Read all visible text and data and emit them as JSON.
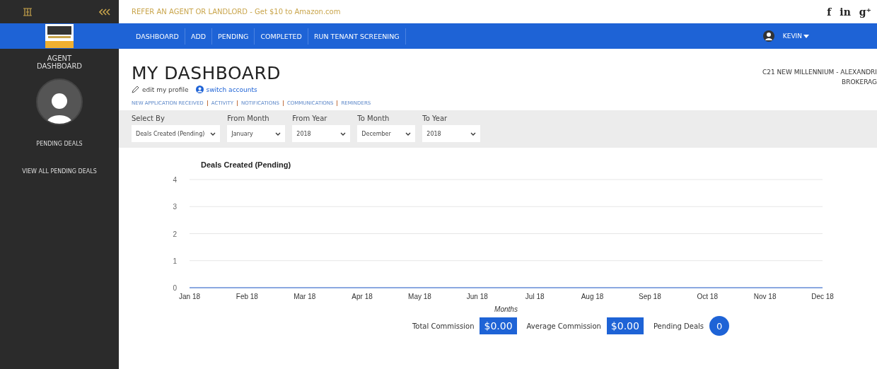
{
  "sidebar": {
    "title": "AGENT DASHBOARD",
    "items": [
      {
        "label": "PENDING DEALS"
      },
      {
        "label": "VIEW ALL PENDING DEALS"
      }
    ]
  },
  "promo": "REFER AN AGENT OR LANDLORD - Get $10 to Amazon.com",
  "social": [
    {
      "label": "f"
    },
    {
      "label": "in"
    },
    {
      "label": "g⁺"
    }
  ],
  "nav": {
    "items": [
      {
        "label": "DASHBOARD"
      },
      {
        "label": "ADD"
      },
      {
        "label": "PENDING"
      },
      {
        "label": "COMPLETED"
      },
      {
        "label": "RUN TENANT SCREENING"
      }
    ],
    "user": "KEVIN"
  },
  "page": {
    "title": "MY DASHBOARD",
    "links": [
      "edit my profile",
      "switch accounts"
    ],
    "office": [
      "C21 NEW MILLENNIUM - ALEXANDRI",
      "BROKERAG"
    ],
    "tabs": [
      "NEW APPLICATION RECEIVED",
      "ACTIVITY",
      "NOTIFICATIONS",
      "COMMUNICATIONS",
      "REMINDERS"
    ]
  },
  "filters": [
    {
      "label": "Select By",
      "value": "Deals Created (Pending)"
    },
    {
      "label": "From Month",
      "value": "January"
    },
    {
      "label": "From Year",
      "value": "2018"
    },
    {
      "label": "To Month",
      "value": "December"
    },
    {
      "label": "To Year",
      "value": "2018"
    }
  ],
  "chart_data": {
    "type": "line",
    "title": "Deals Created (Pending)",
    "xlabel": "Months",
    "categories": [
      "Jan 18",
      "Feb 18",
      "Mar 18",
      "Apr 18",
      "May 18",
      "Jun 18",
      "Jul 18",
      "Aug 18",
      "Sep 18",
      "Oct 18",
      "Nov 18",
      "Dec 18"
    ],
    "series": [
      {
        "color": "#8aa8e0",
        "values": [
          0,
          0,
          0,
          0,
          0,
          0,
          0,
          0,
          0,
          0,
          0,
          0
        ]
      }
    ],
    "grid": true,
    "ylim": [
      0,
      4
    ],
    "yticks": [
      0,
      1,
      2,
      3,
      4
    ]
  },
  "summary": [
    {
      "kind": "box",
      "label": "Total Commission",
      "value": "$0.00"
    },
    {
      "kind": "box",
      "label": "Average Commission",
      "value": "$0.00"
    },
    {
      "kind": "circle",
      "label": "Pending Deals",
      "value": "0"
    }
  ]
}
